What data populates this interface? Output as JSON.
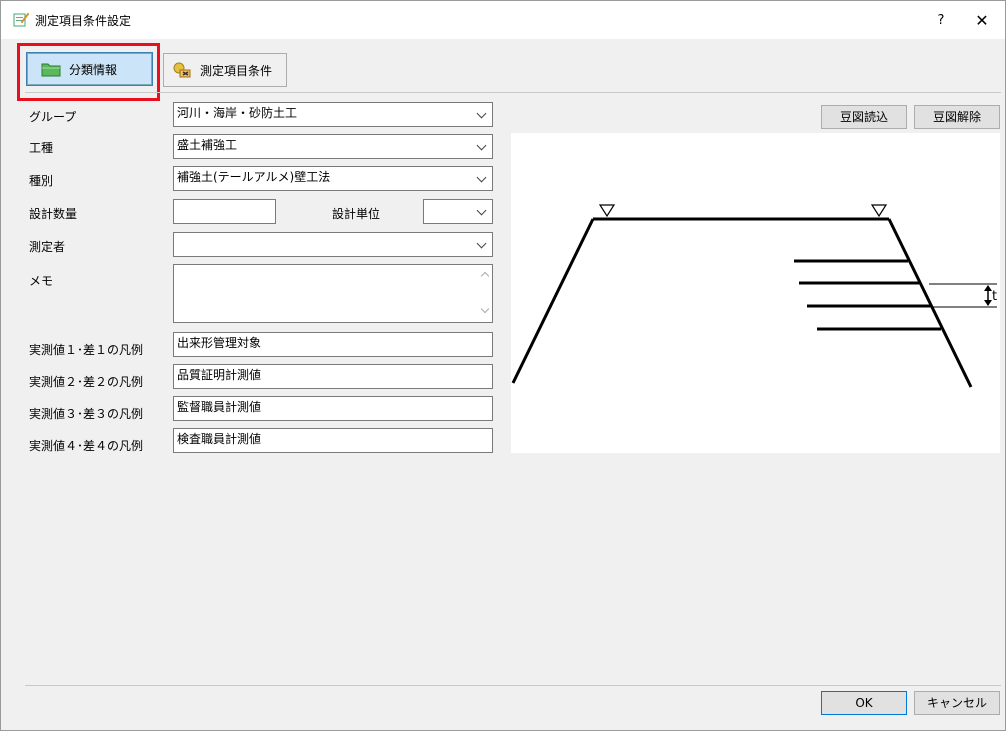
{
  "window": {
    "title": "測定項目条件設定",
    "help": "?",
    "close": "✕"
  },
  "tabs": [
    {
      "label": "分類情報",
      "icon": "folder-icon",
      "active": true
    },
    {
      "label": "測定項目条件",
      "icon": "tools-icon",
      "active": false
    }
  ],
  "form": {
    "group_label": "グループ",
    "group_value": "河川・海岸・砂防土工",
    "worktype_label": "工種",
    "worktype_value": "盛土補強工",
    "category_label": "種別",
    "category_value": "補強土(テールアルメ)壁工法",
    "design_qty_label": "設計数量",
    "design_qty_value": "",
    "design_unit_label": "設計単位",
    "design_unit_value": "",
    "measurer_label": "測定者",
    "measurer_value": "",
    "memo_label": "メモ",
    "memo_value": "",
    "legends": [
      {
        "label": "実測値１･差１の凡例",
        "value": "出来形管理対象"
      },
      {
        "label": "実測値２･差２の凡例",
        "value": "品質証明計測値"
      },
      {
        "label": "実測値３･差３の凡例",
        "value": "監督職員計測値"
      },
      {
        "label": "実測値４･差４の凡例",
        "value": "検査職員計測値"
      }
    ]
  },
  "figure": {
    "load_label": "豆図読込",
    "clear_label": "豆図解除",
    "dim_label": "t"
  },
  "footer": {
    "ok_label": "OK",
    "cancel_label": "キャンセル"
  }
}
